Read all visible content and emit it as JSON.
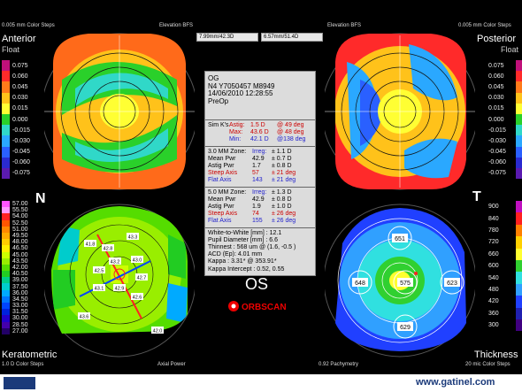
{
  "header": {
    "left_steps": "0.005 mm Color Steps",
    "right_steps": "0.005 mm Color Steps",
    "elev_left": "Elevation BFS",
    "elev_right": "Elevation BFS",
    "box_left": "7.99mm/42.3D",
    "box_right": "6.57mm/51.4D"
  },
  "anterior": {
    "title": "Anterior",
    "sub": "Float"
  },
  "posterior": {
    "title": "Posterior",
    "sub": "Float"
  },
  "keratometric": {
    "title": "Keratometric",
    "sub": "1.0 D Color Steps",
    "label": "Axial Power"
  },
  "thickness": {
    "title": "Thickness",
    "sub": "20 mic Color Steps",
    "label": "0.92 Pachymetry"
  },
  "letters": {
    "nasal": "N",
    "temporal": "T"
  },
  "elev_scale": [
    "0.075",
    "0.060",
    "0.045",
    "0.030",
    "0.015",
    "0.000",
    "-0.015",
    "-0.030",
    "-0.045",
    "-0.060",
    "-0.075"
  ],
  "elev_colors": [
    "#c0107a",
    "#ff2a2a",
    "#ff7a1a",
    "#ffc21a",
    "#ffff33",
    "#2ad02a",
    "#30d8c8",
    "#2aa8ff",
    "#2a60ff",
    "#2a2ad0",
    "#5a1ab0"
  ],
  "kera_scale": [
    "57.00",
    "55.50",
    "54.00",
    "52.50",
    "51.00",
    "49.50",
    "48.00",
    "46.50",
    "45.00",
    "43.50",
    "42.00",
    "40.50",
    "39.00",
    "37.50",
    "36.00",
    "34.50",
    "33.00",
    "31.50",
    "30.00",
    "28.50",
    "27.00"
  ],
  "kera_colors": [
    "#ff55ff",
    "#ff99ff",
    "#ff2222",
    "#ff5500",
    "#ff8800",
    "#ffaa00",
    "#ffcc00",
    "#ffee00",
    "#ccff00",
    "#99ee00",
    "#55dd00",
    "#22cc22",
    "#00cc88",
    "#00cccc",
    "#00aaff",
    "#0077ff",
    "#0044ff",
    "#0022dd",
    "#2200cc",
    "#4400aa",
    "#220066"
  ],
  "thick_scale": [
    "900",
    "840",
    "780",
    "720",
    "660",
    "600",
    "540",
    "480",
    "420",
    "360",
    "300"
  ],
  "thick_colors": [
    "#c010c0",
    "#ff2020",
    "#ff8000",
    "#ffd000",
    "#ffff30",
    "#30d030",
    "#30e0e0",
    "#30a0ff",
    "#2040ff",
    "#2020b0",
    "#400080"
  ],
  "info": {
    "eye": "OG",
    "id": "N4 Y7050457 M8949",
    "datetime": "14/06/2010 12:28:55",
    "preop": "PreOp",
    "simk": {
      "label": "Sim K's",
      "astig_label": "Astig:",
      "astig": "1.5 D",
      "astig_axis": "@ 49 deg",
      "max_label": "Max:",
      "max": "43.6 D",
      "max_axis": "@ 48 deg",
      "min_label": "Min:",
      "min": "42.1 D",
      "min_axis": "@138 deg"
    },
    "zone3": {
      "label": "3.0 MM Zone:",
      "irreg_label": "Irreg:",
      "irreg": "± 1.1 D",
      "mean_label": "Mean Pwr",
      "mean": "42.9",
      "mean_sd": "± 0.7 D",
      "astig_label": "Astig Pwr",
      "astig": "1.7",
      "astig_sd": "± 0.8 D",
      "steep_label": "Steep Axis",
      "steep": "57",
      "steep_sd": "± 21 deg",
      "flat_label": "Flat Axis",
      "flat": "143",
      "flat_sd": "± 21 deg"
    },
    "zone5": {
      "label": "5.0 MM Zone:",
      "irreg_label": "Irreg:",
      "irreg": "± 1.3 D",
      "mean_label": "Mean Pwr",
      "mean": "42.9",
      "mean_sd": "± 0.8 D",
      "astig_label": "Astig Pwr",
      "astig": "1.9",
      "astig_sd": "± 1.0 D",
      "steep_label": "Steep Axis",
      "steep": "74",
      "steep_sd": "± 26 deg",
      "flat_label": "Flat Axis",
      "flat": "155",
      "flat_sd": "± 26 deg"
    },
    "misc": [
      "White-to-White [mm] : 12.1",
      "Pupil Diameter [mm] : 6.6",
      "Thinnest : 568 um @ (1.6, -0.5 )",
      "ACD (Ep): 4.01 mm",
      "Kappa : 3.31* @ 353.91*",
      "Kappa Intercept : 0.52, 0.55"
    ]
  },
  "os_label": "OS",
  "brand": "ORBSCAN",
  "pachy_points": [
    "651",
    "648",
    "575",
    "623",
    "629"
  ],
  "kera_points": [
    "41.8",
    "42.8",
    "43.3",
    "43.0",
    "42.5",
    "43.2",
    "42.7",
    "43.1",
    "42.9",
    "42.6",
    "43.6",
    "42.0"
  ],
  "footer": {
    "site": "www.gatinel.com"
  }
}
